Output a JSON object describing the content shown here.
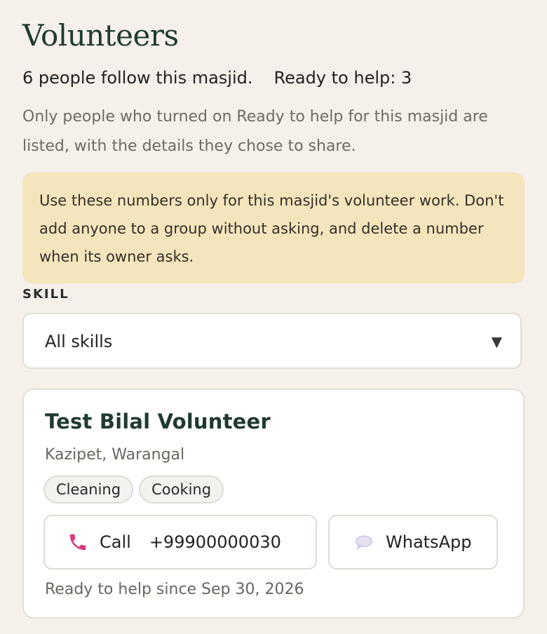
{
  "page": {
    "title": "Volunteers",
    "followers_text": "6 people follow this masjid.",
    "ready_text": "Ready to help: 3",
    "intro_text": "Only people who turned on Ready to help for this masjid are listed, with the details they chose to share."
  },
  "notice": {
    "text": "Use these numbers only for this masjid's volunteer work. Don't add anyone to a group without asking, and delete a number when its owner asks."
  },
  "filter": {
    "label": "SKILL",
    "selected": "All skills",
    "arrow": "▼"
  },
  "volunteers": [
    {
      "name": "Test Bilal Volunteer",
      "location": "Kazipet, Warangal",
      "skills": [
        "Cleaning",
        "Cooking"
      ],
      "call_label": "Call",
      "phone": "+99900000030",
      "whatsapp_label": "WhatsApp",
      "since": "Ready to help since Sep 30, 2026"
    }
  ],
  "colors": {
    "background": "#f5f1ea",
    "title": "#1f3b2e",
    "notice_bg": "#f4e5bd",
    "phone_icon": "#d63a7e",
    "chat_icon": "#c9bfe0"
  },
  "icons": {
    "call": "phone-icon",
    "whatsapp": "chat-bubble-icon",
    "dropdown": "chevron-down-icon"
  }
}
